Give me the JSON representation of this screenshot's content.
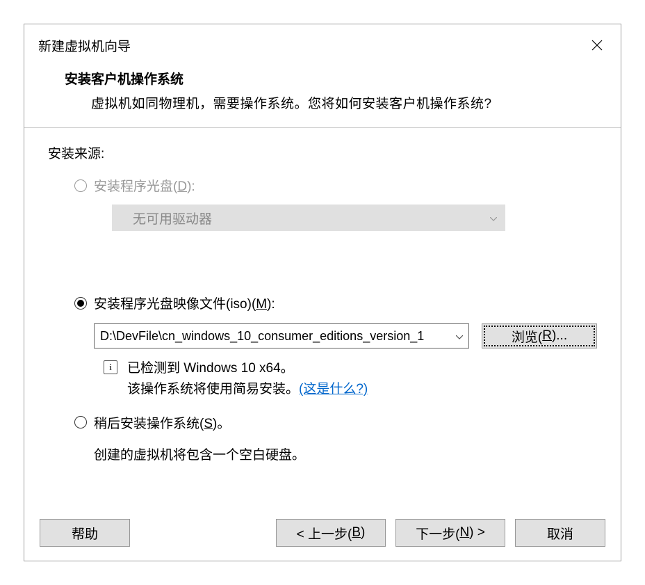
{
  "dialog": {
    "title": "新建虚拟机向导"
  },
  "header": {
    "title": "安装客户机操作系统",
    "subtitle": "虚拟机如同物理机，需要操作系统。您将如何安装客户机操作系统?"
  },
  "source": {
    "label": "安装来源:",
    "option_disc": {
      "prefix": "安装程序光盘(",
      "key": "D",
      "suffix": "):",
      "dropdown": "无可用驱动器"
    },
    "option_iso": {
      "prefix": "安装程序光盘映像文件(iso)(",
      "key": "M",
      "suffix": "):",
      "path": "D:\\DevFile\\cn_windows_10_consumer_editions_version_1",
      "browse_prefix": "浏览(",
      "browse_key": "R",
      "browse_suffix": ")...",
      "detected": "已检测到 Windows 10 x64。",
      "easy_install": "该操作系统将使用简易安装。",
      "whats_this": "(这是什么?)"
    },
    "option_later": {
      "prefix": "稍后安装操作系统(",
      "key": "S",
      "suffix": ")。",
      "note": "创建的虚拟机将包含一个空白硬盘。"
    }
  },
  "buttons": {
    "help": "帮助",
    "prev_prefix": "< 上一步(",
    "prev_key": "B",
    "prev_suffix": ")",
    "next_prefix": "下一步(",
    "next_key": "N",
    "next_suffix": ") >",
    "cancel": "取消"
  }
}
